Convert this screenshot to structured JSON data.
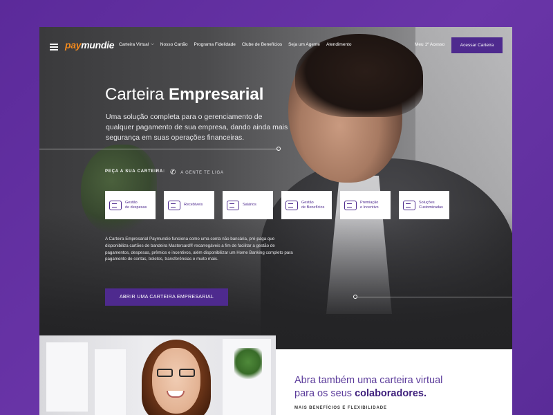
{
  "colors": {
    "brand_purple": "#4e2a8e",
    "logo_orange": "#f28a1e",
    "background_purple": "#5f2e9e"
  },
  "logo": {
    "part1": "pay",
    "part2": "mundie"
  },
  "nav": {
    "items": [
      {
        "label": "Carteira Virtual",
        "has_dropdown": true
      },
      {
        "label": "Nosso Cartão"
      },
      {
        "label": "Programa Fidelidade"
      },
      {
        "label": "Clube de Benefícios"
      },
      {
        "label": "Seja um Agente"
      },
      {
        "label": "Atendimento"
      }
    ],
    "meu_acesso": "Meu 1º Acesso",
    "acessar_button": "Acessar Carteira"
  },
  "hero": {
    "title_light": "Carteira",
    "title_bold": "Empresarial",
    "subtitle": "Uma solução completa para o gerenciamento de qualquer pagamento de sua empresa, dando ainda mais segurança em suas operações financeiras.",
    "peca_label": "PEÇA A SUA CARTEIRA:",
    "gente_label": "A GENTE TE LIGA",
    "cards": [
      {
        "icon": "piggy-bank-icon",
        "label": "Gestão\nde despesas"
      },
      {
        "icon": "cash-icon",
        "label": "Recebíveis"
      },
      {
        "icon": "wallet-icon",
        "label": "Salários"
      },
      {
        "icon": "document-icon",
        "label": "Gestão\nde Benefícios"
      },
      {
        "icon": "coins-icon",
        "label": "Premiação\ne Incentivo"
      },
      {
        "icon": "card-solutions-icon",
        "label": "Soluções\nCustomizadas"
      }
    ],
    "description": "A Carteira Empresarial Paymundie funciona como uma conta não bancária, pré-paga que disponibiliza cartões de bandeira Mastercard® recarregáveis a fim de facilitar a gestão de pagamentos, despesas, prêmios e incentivos, além disponibilizar um Home Banking completo para pagamento de contas, boletos, transferências e muito mais.",
    "cta": "ABRIR UMA CARTEIRA EMPRESARIAL"
  },
  "bottom": {
    "heading_line1": "Abra também uma carteira virtual",
    "heading_line2_light": "para os seus",
    "heading_line2_bold": "colaboradores.",
    "tagline": "MAIS BENEFÍCIOS E FLEXIBILIDADE"
  }
}
